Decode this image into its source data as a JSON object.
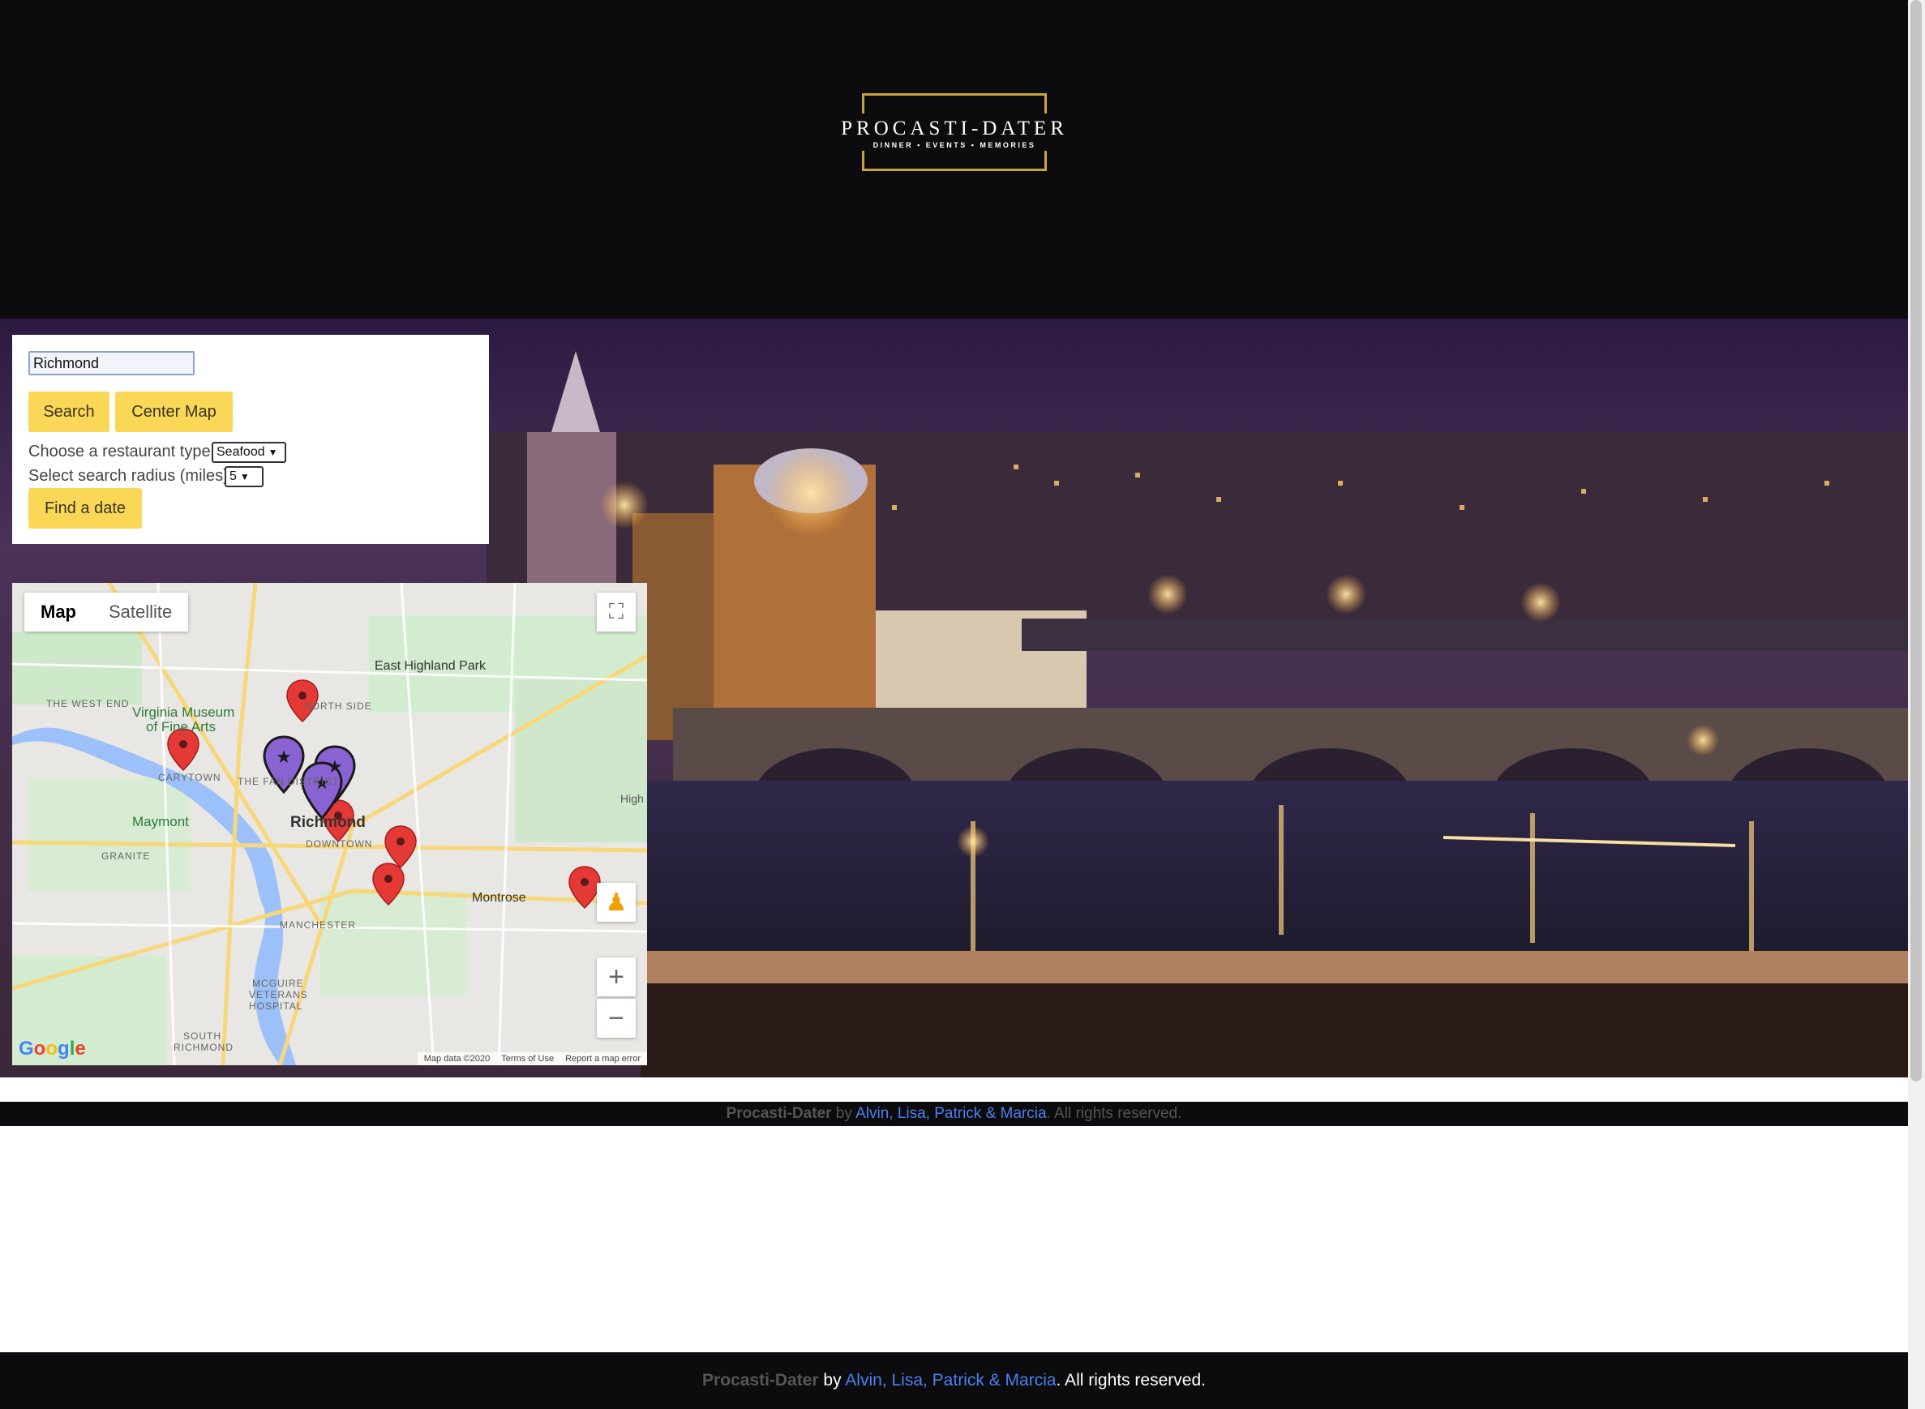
{
  "header": {
    "logo_title": "PROCASTI-DATER",
    "logo_tagline": "DINNER • EVENTS • MEMORIES"
  },
  "search": {
    "city_value": "Richmond",
    "search_label": "Search",
    "center_label": "Center Map",
    "type_label": "Choose a restaurant type",
    "type_value": "Seafood",
    "radius_label": "Select search radius (miles)",
    "radius_value": "5",
    "find_label": "Find a date"
  },
  "map": {
    "tab_map": "Map",
    "tab_satellite": "Satellite",
    "labels": {
      "east_highland_park": "East Highland Park",
      "the_west_end": "THE WEST END",
      "virginia_museum": "Virginia Museum",
      "of_fine_arts": "of Fine Arts",
      "carytown": "CARYTOWN",
      "maymont": "Maymont",
      "granite": "GRANITE",
      "richmond": "Richmond",
      "downtown": "DOWNTOWN",
      "northside": "NORTH SIDE",
      "fan_district": "THE FAN DISTRICT",
      "manchester": "MANCHESTER",
      "montrose": "Montrose",
      "mcguire_1": "MCGUIRE",
      "mcguire_2": "VETERANS",
      "mcguire_3": "HOSPITAL",
      "south_richmond_1": "SOUTH",
      "south_richmond_2": "RICHMOND",
      "high_spr": "High Spr"
    },
    "attribution": {
      "map_data": "Map data ©2020",
      "terms": "Terms of Use",
      "report": "Report a map error"
    },
    "google": "Google"
  },
  "footer": {
    "brand": "Procasti-Dater",
    "by": " by ",
    "authors": "Alvin, Lisa, Patrick & Marcia",
    "rights": ". All rights reserved."
  },
  "colors": {
    "accent_button": "#fbd757",
    "logo_gold": "#c9a43a",
    "header_bg": "#0c0b0d",
    "link_blue": "#4c80f0",
    "pin_red": "#e53935",
    "pin_purple": "#8a63d2"
  }
}
